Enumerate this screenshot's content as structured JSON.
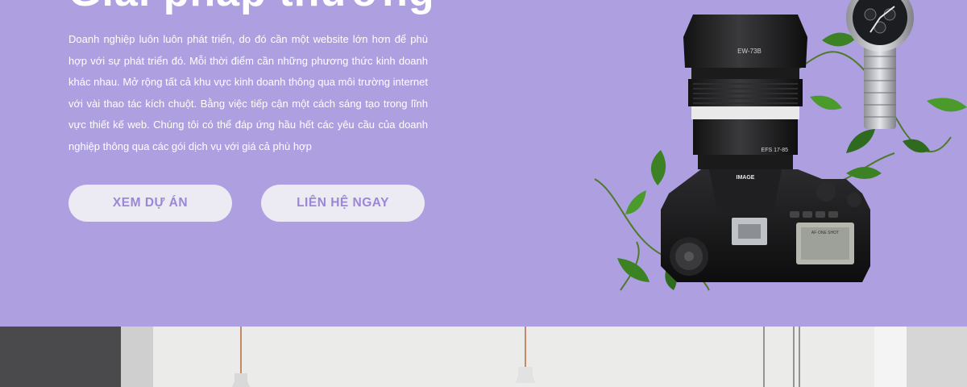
{
  "hero": {
    "title_partial": "Giải pháp thương",
    "description": "Doanh nghiệp luôn luôn phát triển, do đó cần một website lớn hơn để phù hợp với sự phát triển đó. Mỗi thời điểm cần những phương thức kinh doanh khác nhau. Mở rộng tất cả khu vực kinh doanh thông qua môi trường internet với vài thao tác kích chuột. Bằng việc tiếp cận một cách sáng tạo trong lĩnh vực thiết kế web. Chúng tôi có thể đáp ứng hầu hết các yêu cầu của doanh nghiệp thông qua các gói dịch vụ với giá cả phù hợp",
    "buttons": {
      "view_projects": "XEM DỰ ÁN",
      "contact": "LIÊN HỆ NGAY"
    }
  },
  "product_image": {
    "lens_label": "EW-73B",
    "camera_brand": "IMAGE",
    "lens_spec": "EFS 17-85",
    "display_text": "AF·ONE SHOT"
  },
  "colors": {
    "hero_bg": "#ad9fe0",
    "button_bg": "#eceaf2",
    "button_text": "#9a87d6",
    "text": "#ffffff"
  },
  "icons": [
    "camera-image",
    "watch-image",
    "ivy-leaves",
    "pendant-lamp"
  ]
}
